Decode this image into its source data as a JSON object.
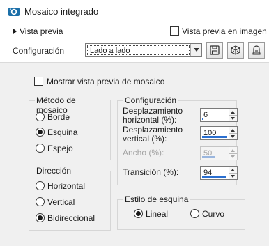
{
  "window": {
    "title": "Mosaico integrado",
    "icon": "app-logo-icon"
  },
  "preview": {
    "expand_label": "Vista previa",
    "image_preview_label": "Vista previa en imagen",
    "image_preview_checked": false
  },
  "config_bar": {
    "label": "Configuración",
    "preset_value": "Lado a lado",
    "buttons": [
      "save-preset-icon",
      "randomize-icon",
      "reset-icon"
    ]
  },
  "mosaic_preview": {
    "label": "Mostrar vista previa de mosaico",
    "checked": false
  },
  "method": {
    "title": "Método de mosaico",
    "options": [
      "Borde",
      "Esquina",
      "Espejo"
    ],
    "selected": "Esquina"
  },
  "direction": {
    "title": "Dirección",
    "options": [
      "Horizontal",
      "Vertical",
      "Bidireccional"
    ],
    "selected": "Bidireccional"
  },
  "configuration": {
    "title": "Configuración",
    "fields": [
      {
        "label_line1": "Desplazamiento",
        "label_line2": "horizontal (%):",
        "value": "6",
        "fill": 0.06,
        "enabled": true
      },
      {
        "label_line1": "Desplazamiento",
        "label_line2": "vertical (%):",
        "value": "100",
        "fill": 1.0,
        "enabled": true
      },
      {
        "label_line1": "Ancho (%):",
        "label_line2": "",
        "value": "50",
        "fill": 0.5,
        "enabled": false
      },
      {
        "label_line1": "Transición (%):",
        "label_line2": "",
        "value": "94",
        "fill": 0.94,
        "enabled": true
      }
    ]
  },
  "corner_style": {
    "title": "Estilo de esquina",
    "options": [
      "Lineal",
      "Curvo"
    ],
    "selected": "Lineal"
  },
  "colors": {
    "panel_bg": "#f0f0f0",
    "accent": "#2a6fd0"
  }
}
